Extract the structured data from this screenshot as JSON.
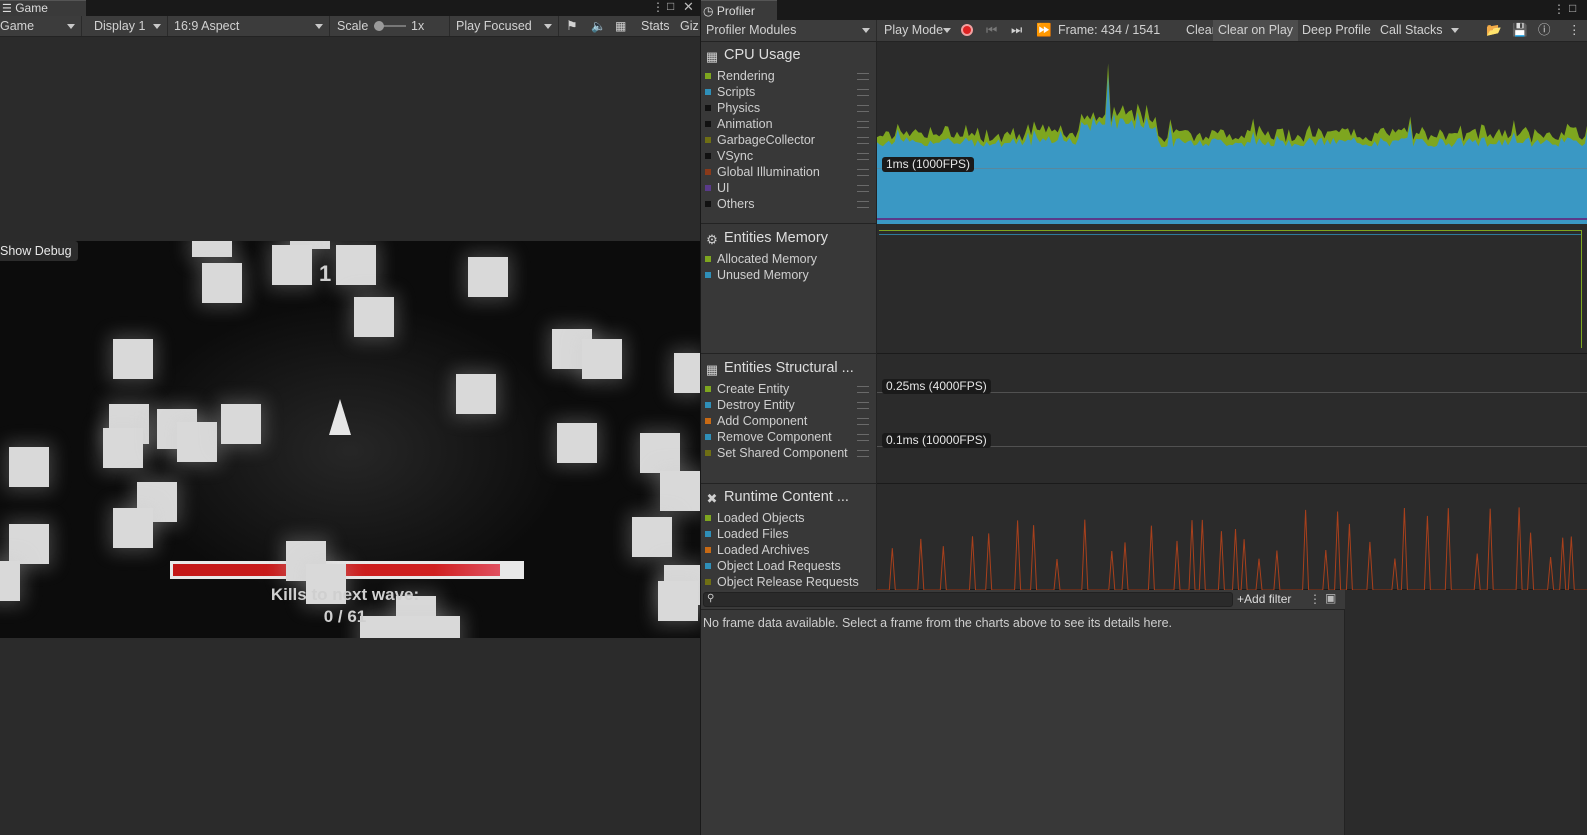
{
  "game_window": {
    "tab_title": "Game",
    "toolbar": {
      "view_mode": "Game",
      "display": "Display 1",
      "aspect": "16:9 Aspect",
      "scale_label": "Scale",
      "scale_value": "1x",
      "play_mode": "Play Focused",
      "stats_label": "Stats",
      "gizmos_label": "Giz"
    },
    "show_debug_label": "Show Debug",
    "hud": {
      "score": "1",
      "kills_label": "Kills to next wave:",
      "kills_value": "0 / 61",
      "health_fraction": 0.94
    }
  },
  "profiler": {
    "tab_title": "Profiler",
    "toolbar": {
      "modules_label": "Profiler Modules",
      "mode_label": "Play Mode",
      "frame_label": "Frame: 434 / 1541",
      "clear": "Clear",
      "clear_on_play": "Clear on Play",
      "deep_profile": "Deep Profile",
      "call_stacks": "Call Stacks"
    },
    "modules": [
      {
        "title": "CPU Usage",
        "icon": "cpu-icon",
        "legend": [
          {
            "label": "Rendering",
            "color": "#7ea61f"
          },
          {
            "label": "Scripts",
            "color": "#2f8fb8"
          },
          {
            "label": "Physics",
            "color": "#1a1a1a"
          },
          {
            "label": "Animation",
            "color": "#1a1a1a"
          },
          {
            "label": "GarbageCollector",
            "color": "#6f6f14"
          },
          {
            "label": "VSync",
            "color": "#1a1a1a"
          },
          {
            "label": "Global Illumination",
            "color": "#8a3a1a"
          },
          {
            "label": "UI",
            "color": "#5a3a8a"
          },
          {
            "label": "Others",
            "color": "#1a1a1a"
          }
        ],
        "marker": "1ms (1000FPS)"
      },
      {
        "title": "Entities Memory",
        "icon": "gear-icon",
        "legend": [
          {
            "label": "Allocated Memory",
            "color": "#7ea61f"
          },
          {
            "label": "Unused Memory",
            "color": "#2f8fb8"
          }
        ]
      },
      {
        "title": "Entities Structural ...",
        "icon": "cpu-icon",
        "legend": [
          {
            "label": "Create Entity",
            "color": "#7ea61f"
          },
          {
            "label": "Destroy Entity",
            "color": "#2f8fb8"
          },
          {
            "label": "Add Component",
            "color": "#c86a14"
          },
          {
            "label": "Remove Component",
            "color": "#2f8fb8"
          },
          {
            "label": "Set Shared Component",
            "color": "#6f6f14"
          }
        ],
        "markers": [
          "0.25ms (4000FPS)",
          "0.1ms (10000FPS)"
        ]
      },
      {
        "title": "Runtime Content ...",
        "icon": "tools-icon",
        "legend": [
          {
            "label": "Loaded Objects",
            "color": "#7ea61f"
          },
          {
            "label": "Loaded Files",
            "color": "#2f8fb8"
          },
          {
            "label": "Loaded Archives",
            "color": "#c86a14"
          },
          {
            "label": "Object Load Requests",
            "color": "#2f8fb8"
          },
          {
            "label": "Object Release Requests",
            "color": "#6f6f14"
          }
        ]
      }
    ],
    "details": {
      "add_filter": "Add filter",
      "empty_message": "No frame data available. Select a frame from the charts above to see its details here."
    }
  }
}
